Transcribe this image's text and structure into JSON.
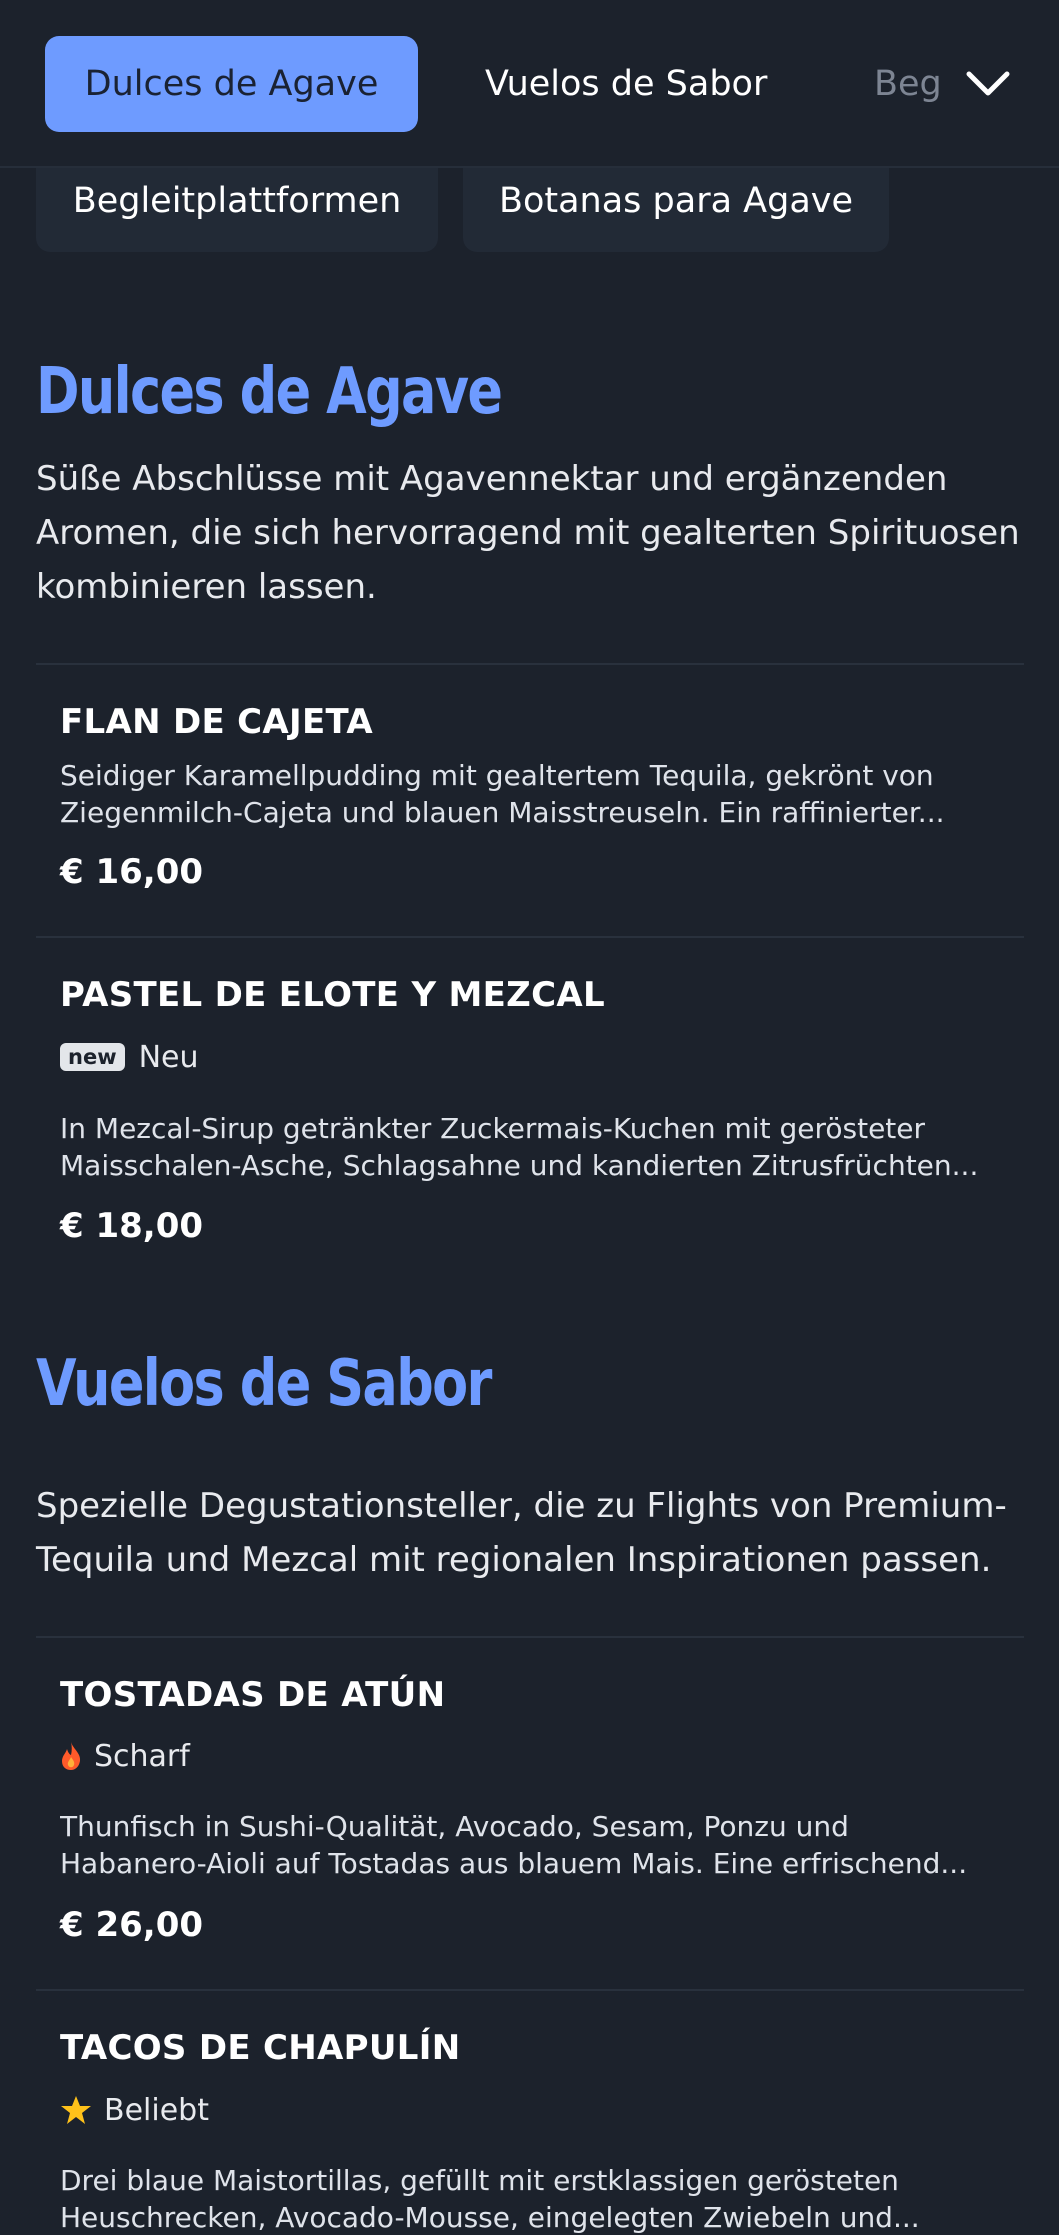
{
  "nav": {
    "tabs": [
      {
        "label": "Dulces de Agave",
        "active": true
      },
      {
        "label": "Vuelos de Sabor",
        "active": false
      },
      {
        "label": "Begleitplattformen",
        "active": false
      }
    ],
    "pills": [
      {
        "label": "Begleitplattformen"
      },
      {
        "label": "Botanas para Agave"
      }
    ],
    "expand_icon": "chevron-down-icon",
    "accent_color": "#6e9bff"
  },
  "sections": [
    {
      "title": "Dulces de Agave",
      "description": "Süße Abschlüsse mit Agavennektar und ergänzenden Aromen, die sich hervorragend mit gealterten Spirituosen kombinieren lassen.",
      "items": [
        {
          "name": "FLAN DE CAJETA",
          "description_lines": [
            "Seidiger Karamellpudding mit gealtertem Tequila, gekrönt von",
            "Ziegenmilch-Cajeta und blauen Maisstreuseln. Ein raffinierter..."
          ],
          "price": "€ 16,00"
        },
        {
          "name": "PASTEL DE ELOTE Y MEZCAL",
          "badge_tag": "new",
          "badge_label": "Neu",
          "description_lines": [
            "In Mezcal-Sirup getränkter Zuckermais-Kuchen mit gerösteter",
            "Maisschalen-Asche, Schlagsahne und kandierten Zitrusfrüchten..."
          ],
          "price": "€ 18,00"
        }
      ]
    },
    {
      "title": "Vuelos de Sabor",
      "description": "Spezielle Degustationsteller, die zu Flights von Premium-Tequila und Mezcal mit regionalen Inspirationen passen.",
      "items": [
        {
          "name": "TOSTADAS DE ATÚN",
          "badge_icon": "flame-icon",
          "badge_label": "Scharf",
          "description_lines": [
            "Thunfisch in Sushi-Qualität, Avocado, Sesam, Ponzu und",
            "Habanero-Aioli auf Tostadas aus blauem Mais. Eine erfrischend..."
          ],
          "price": "€ 26,00"
        },
        {
          "name": "TACOS DE CHAPULÍN",
          "badge_icon": "star-icon",
          "badge_label": "Beliebt",
          "description_lines": [
            "Drei blaue Maistortillas, gefüllt mit erstklassigen gerösteten",
            "Heuschrecken, Avocado-Mousse, eingelegten Zwiebeln und..."
          ]
        }
      ]
    }
  ]
}
